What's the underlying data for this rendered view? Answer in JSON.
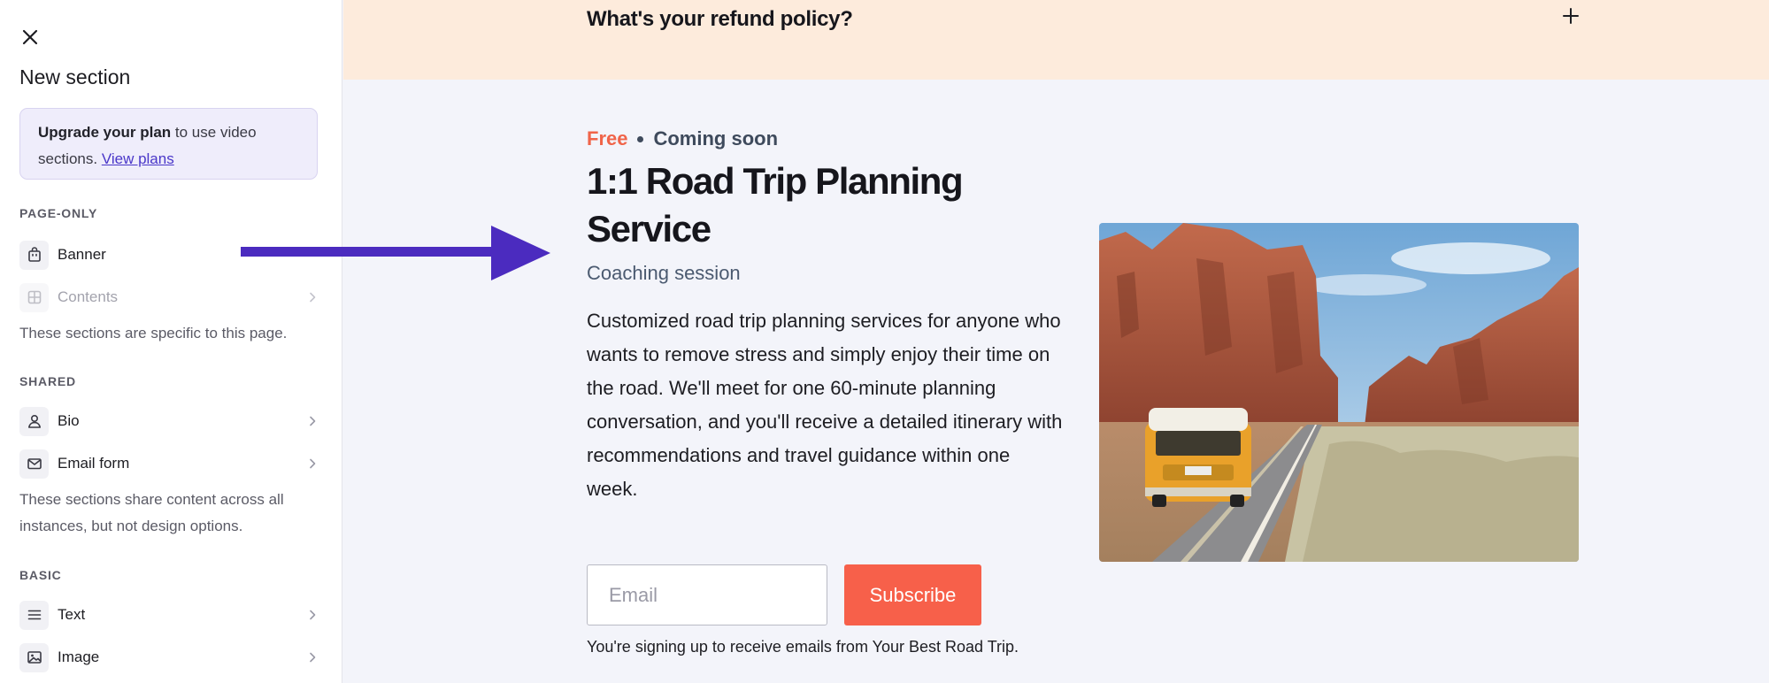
{
  "sidebar": {
    "title": "New section",
    "upgrade": {
      "bold": "Upgrade your plan",
      "text": " to use video sections. ",
      "link": "View plans"
    },
    "page_only": {
      "label": "PAGE-ONLY",
      "items": [
        {
          "label": "Banner",
          "icon": "bag-icon"
        },
        {
          "label": "Contents",
          "icon": "grid-icon",
          "disabled": true
        }
      ],
      "description": "These sections are specific to this page."
    },
    "shared": {
      "label": "SHARED",
      "items": [
        {
          "label": "Bio",
          "icon": "person-icon"
        },
        {
          "label": "Email form",
          "icon": "envelope-icon"
        }
      ],
      "description": "These sections share content across all instances, but not design options."
    },
    "basic": {
      "label": "BASIC",
      "items": [
        {
          "label": "Text",
          "icon": "text-lines-icon"
        },
        {
          "label": "Image",
          "icon": "image-icon"
        }
      ]
    }
  },
  "faq": {
    "question": "What's your refund policy?"
  },
  "product": {
    "price": "Free",
    "status": "Coming soon",
    "title": "1:1 Road Trip Planning Service",
    "subtitle": "Coaching session",
    "description": "Customized road trip planning services for anyone who wants to remove stress and simply enjoy their time on the road. We'll meet for one 60-minute planning conversation, and you'll receive a detailed itinerary with recommendations and travel guidance within one week.",
    "email_placeholder": "Email",
    "subscribe_label": "Subscribe",
    "signup_note": "You're signing up to receive emails from Your Best Road Trip."
  },
  "colors": {
    "accent_orange": "#f7604a",
    "annotation_arrow": "#4b2bbf",
    "faq_band": "#fdebdc"
  }
}
